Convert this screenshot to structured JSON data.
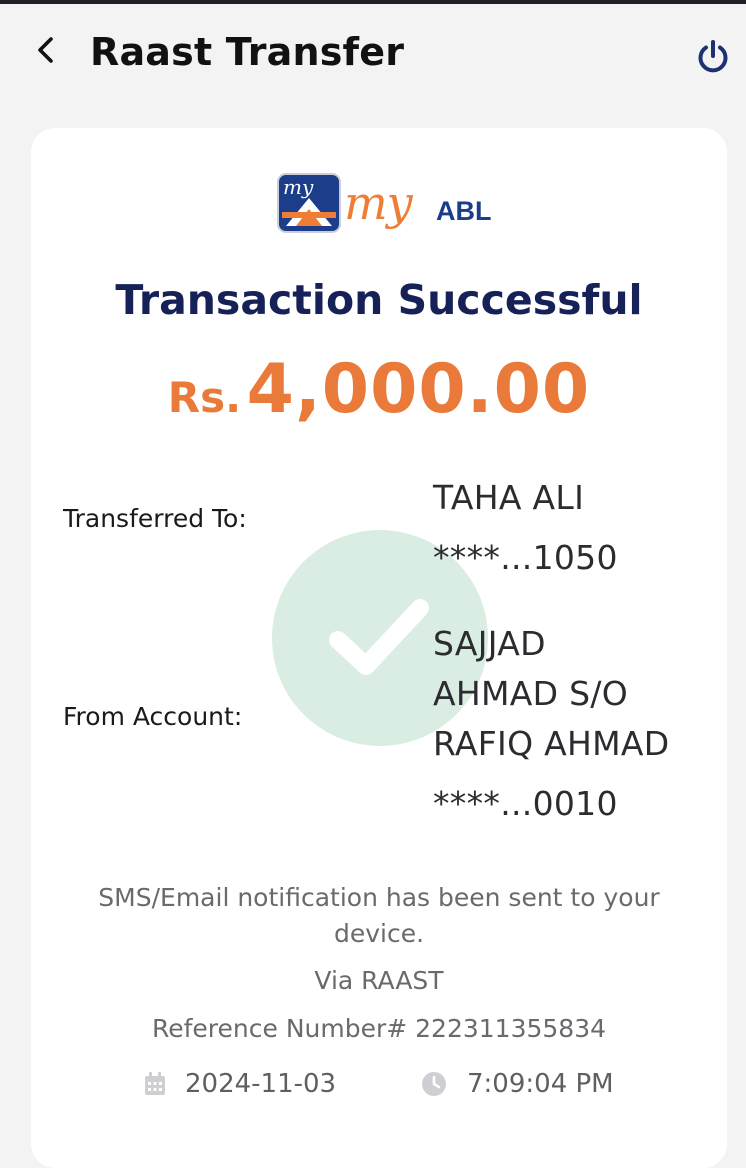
{
  "header": {
    "title": "Raast Transfer",
    "back_icon": "chevron-left-icon",
    "power_icon": "power-icon"
  },
  "receipt": {
    "logo": {
      "brand_script": "my",
      "brand_name": "ABL"
    },
    "status_title": "Transaction Successful",
    "amount": {
      "currency": "Rs.",
      "value": "4,000.00"
    },
    "transferred_to": {
      "label": "Transferred To:",
      "name": "TAHA ALI",
      "account": "****...1050"
    },
    "from_account": {
      "label": "From Account:",
      "name_line1": "SAJJAD",
      "name_line2": "AHMAD S/O",
      "name_line3": "RAFIQ AHMAD",
      "account": "****...0010"
    },
    "notice": "SMS/Email notification has been sent to your device.",
    "via": "Via RAAST",
    "reference": "Reference Number# 222311355834",
    "date": "2024-11-03",
    "time": "7:09:04 PM"
  },
  "colors": {
    "accent_orange": "#ea7a3a",
    "navy": "#152157",
    "success_watermark": "#d9ede2",
    "power_icon": "#1c3170"
  }
}
